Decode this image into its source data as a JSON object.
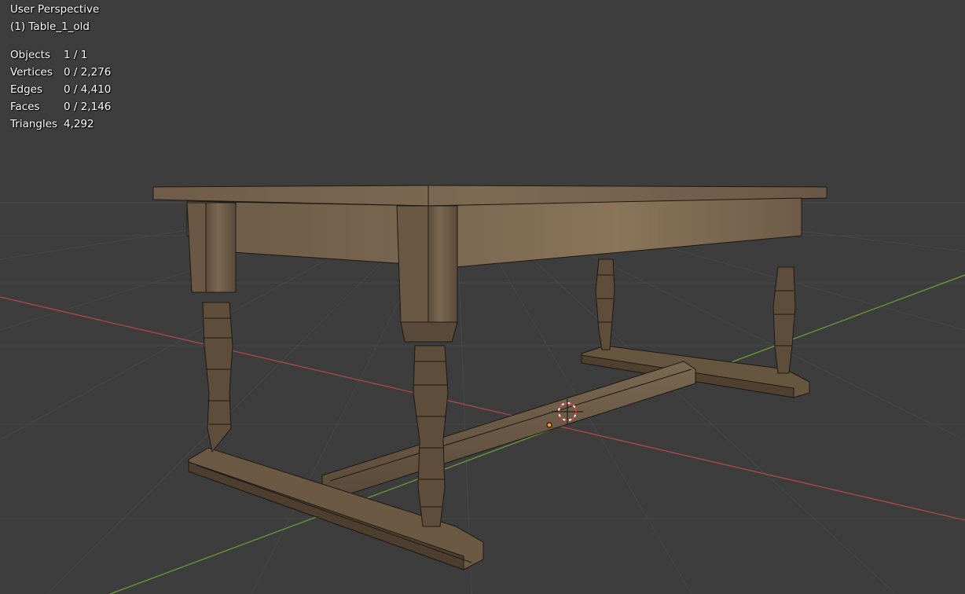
{
  "viewport": {
    "view_name": "User Perspective",
    "active_object": "(1) Table_1_old",
    "stats": [
      {
        "label": "Objects",
        "value": "1 / 1"
      },
      {
        "label": "Vertices",
        "value": "0 / 2,276"
      },
      {
        "label": "Edges",
        "value": "0 / 4,410"
      },
      {
        "label": "Faces",
        "value": "0 / 2,146"
      },
      {
        "label": "Triangles",
        "value": "4,292"
      }
    ],
    "colors": {
      "background": "#3d3d3d",
      "grid": "#474747",
      "x_axis": "#b0474f",
      "y_axis": "#6a9a3a",
      "wood_light": "#7a6750",
      "wood_dark": "#5b4a38",
      "wire": "#1e1a15",
      "cursor": "#e04040",
      "origin": "#ff9a1a"
    }
  }
}
